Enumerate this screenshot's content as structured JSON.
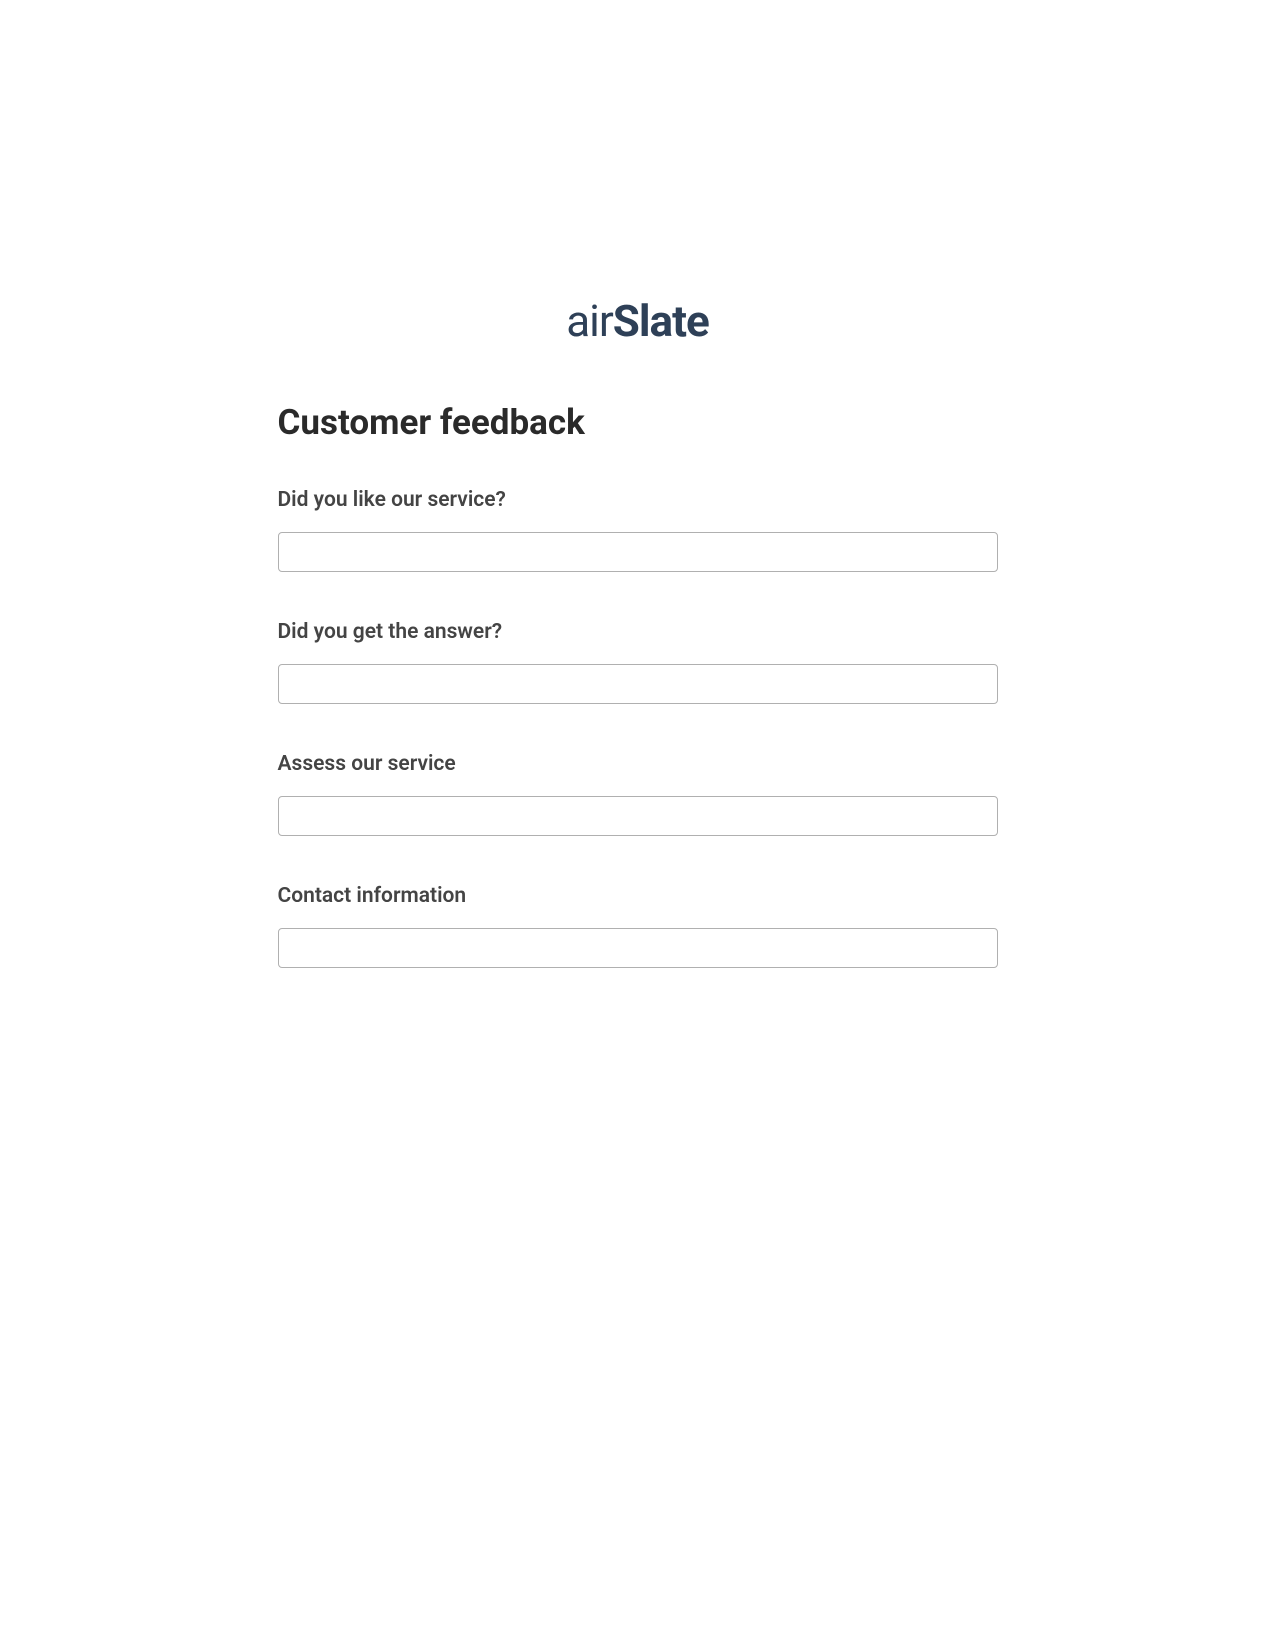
{
  "logo": {
    "part1": "air",
    "part2": "Slate"
  },
  "form": {
    "title": "Customer feedback",
    "fields": [
      {
        "label": "Did you like our service?",
        "value": ""
      },
      {
        "label": "Did you get the answer?",
        "value": ""
      },
      {
        "label": "Assess our service",
        "value": ""
      },
      {
        "label": "Contact information",
        "value": ""
      }
    ]
  }
}
